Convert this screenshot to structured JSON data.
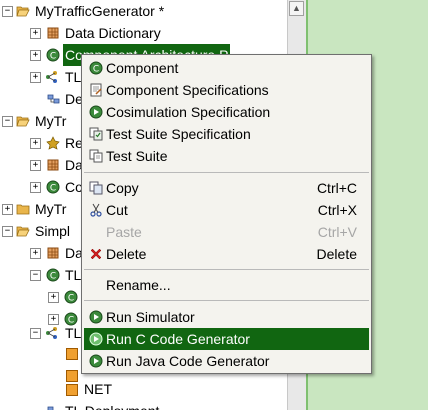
{
  "tree": {
    "items": [
      {
        "label": "MyTrafficGenerator *",
        "selected": false
      },
      {
        "label": "Data Dictionary",
        "selected": false
      },
      {
        "label": "Component Architecture P",
        "selected": true
      },
      {
        "label": "TL",
        "selected": false
      },
      {
        "label": "De",
        "selected": false
      },
      {
        "label": "MyTr",
        "selected": false
      },
      {
        "label": "Re",
        "selected": false
      },
      {
        "label": "Da",
        "selected": false
      },
      {
        "label": "Co",
        "selected": false
      },
      {
        "label": "MyTr",
        "selected": false
      },
      {
        "label": "Simpl",
        "selected": false
      },
      {
        "label": "Da",
        "selected": false
      },
      {
        "label": "TL",
        "selected": false
      },
      {
        "label": "",
        "selected": false
      },
      {
        "label": "",
        "selected": false
      },
      {
        "label": "TL",
        "selected": false
      },
      {
        "label": "",
        "selected": false
      },
      {
        "label": "",
        "selected": false
      },
      {
        "label": "NET",
        "selected": false
      },
      {
        "label": "TL Deployment",
        "selected": false
      }
    ]
  },
  "context_menu": {
    "items": [
      {
        "label": "Component",
        "icon": "component-icon",
        "shortcut": "",
        "enabled": true,
        "highlighted": false
      },
      {
        "label": "Component Specifications",
        "icon": "specification-icon",
        "shortcut": "",
        "enabled": true,
        "highlighted": false
      },
      {
        "label": "Cosimulation Specification",
        "icon": "run-icon",
        "shortcut": "",
        "enabled": true,
        "highlighted": false
      },
      {
        "label": "Test Suite Specification",
        "icon": "test-suite-spec-icon",
        "shortcut": "",
        "enabled": true,
        "highlighted": false
      },
      {
        "label": "Test Suite",
        "icon": "test-suite-icon",
        "shortcut": "",
        "enabled": true,
        "highlighted": false
      },
      {
        "label": "Copy",
        "icon": "copy-icon",
        "shortcut": "Ctrl+C",
        "enabled": true,
        "highlighted": false
      },
      {
        "label": "Cut",
        "icon": "cut-icon",
        "shortcut": "Ctrl+X",
        "enabled": true,
        "highlighted": false
      },
      {
        "label": "Paste",
        "icon": "",
        "shortcut": "Ctrl+V",
        "enabled": false,
        "highlighted": false
      },
      {
        "label": "Delete",
        "icon": "delete-icon",
        "shortcut": "Delete",
        "enabled": true,
        "highlighted": false
      },
      {
        "label": "Rename...",
        "icon": "",
        "shortcut": "",
        "enabled": true,
        "highlighted": false
      },
      {
        "label": "Run Simulator",
        "icon": "run-icon",
        "shortcut": "",
        "enabled": true,
        "highlighted": false
      },
      {
        "label": "Run C Code Generator",
        "icon": "run-icon",
        "shortcut": "",
        "enabled": true,
        "highlighted": true
      },
      {
        "label": "Run Java Code Generator",
        "icon": "run-icon",
        "shortcut": "",
        "enabled": true,
        "highlighted": false
      }
    ]
  },
  "colors": {
    "highlight": "#116611",
    "right_pane": "#c9e6c0",
    "menu_bg": "#f4f3ee"
  }
}
